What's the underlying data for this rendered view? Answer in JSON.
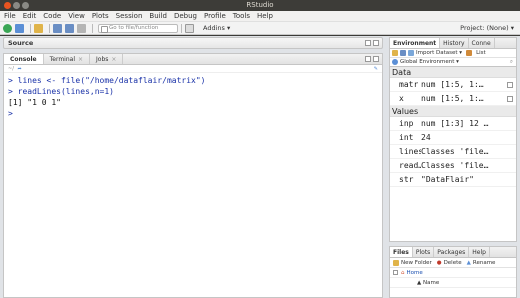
{
  "window": {
    "title": "RStudio"
  },
  "menu": [
    "File",
    "Edit",
    "Code",
    "View",
    "Plots",
    "Session",
    "Build",
    "Debug",
    "Profile",
    "Tools",
    "Help"
  ],
  "toolbar": {
    "goto_placeholder": "Go to file/function",
    "addins_label": "Addins ▾",
    "project_label": "Project: (None) ▾"
  },
  "source": {
    "title": "Source"
  },
  "console": {
    "tabs": [
      "Console",
      "Terminal",
      "Jobs"
    ],
    "cwd": "~/",
    "lines": [
      {
        "type": "input",
        "text": "> lines <- file(\"/home/dataflair/matrix\")"
      },
      {
        "type": "input",
        "text": "> readLines(lines,n=1)"
      },
      {
        "type": "output",
        "text": "[1] \"1 0 1\""
      },
      {
        "type": "prompt",
        "text": ">"
      }
    ]
  },
  "environment": {
    "tabs": [
      "Environment",
      "History",
      "Conne"
    ],
    "import_label": "Import Dataset ▾",
    "list_label": "List",
    "global_env_label": "Global Environment ▾",
    "sections": [
      {
        "title": "Data",
        "rows": [
          {
            "name": "matr",
            "value": "num [1:5, 1:…",
            "grid": true
          },
          {
            "name": "x",
            "value": "num [1:5, 1:…",
            "grid": true
          }
        ]
      },
      {
        "title": "Values",
        "rows": [
          {
            "name": "inp",
            "value": "num [1:3] 12 …",
            "grid": false
          },
          {
            "name": "int",
            "value": "24",
            "grid": false
          },
          {
            "name": "lines",
            "value": "Classes 'file…",
            "grid": false
          },
          {
            "name": "read…",
            "value": "Classes 'file…",
            "grid": false
          },
          {
            "name": "str",
            "value": "\"DataFlair\"",
            "grid": false
          }
        ]
      }
    ]
  },
  "files": {
    "tabs": [
      "Files",
      "Plots",
      "Packages",
      "Help"
    ],
    "new_folder_label": "New Folder",
    "delete_label": "Delete",
    "rename_label": "Rename",
    "home_label": "Home",
    "name_header": "▲ Name"
  },
  "colors": {
    "console_input": "#1a32a8",
    "link": "#1a4fb0"
  }
}
